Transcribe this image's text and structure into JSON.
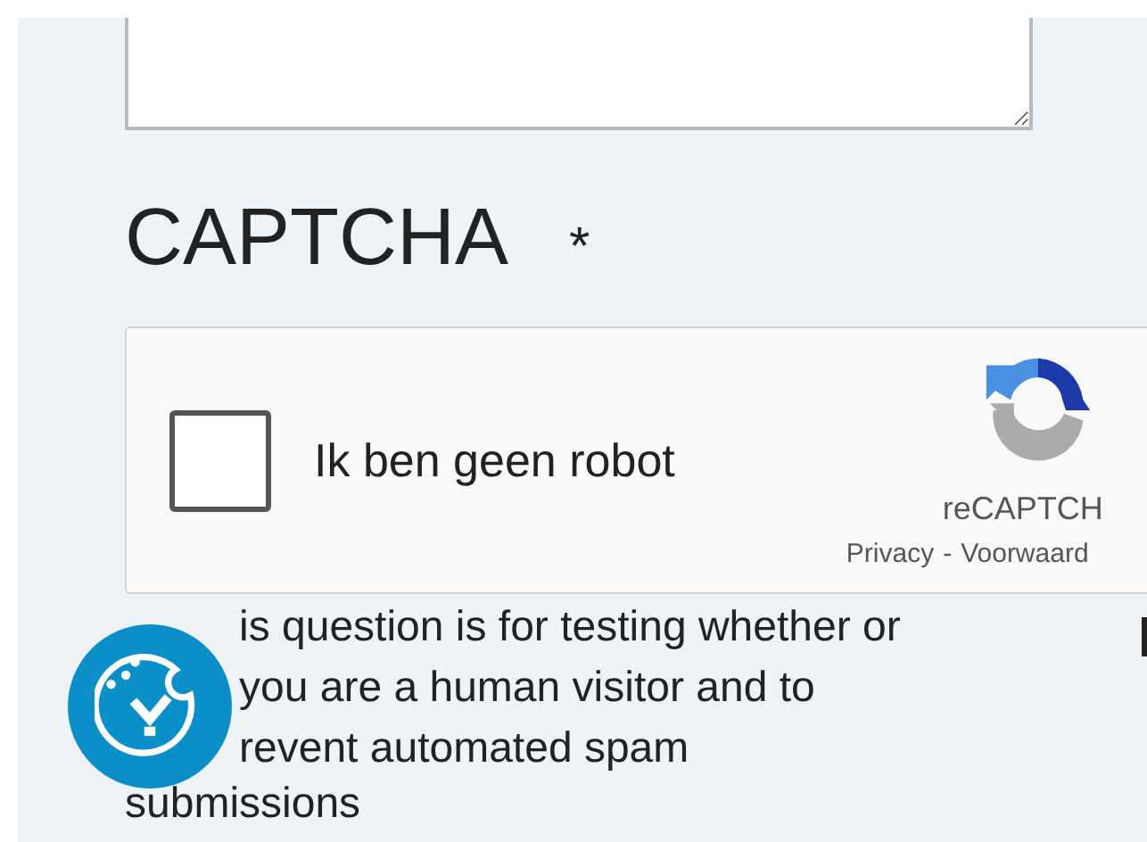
{
  "captcha": {
    "label": "CAPTCHA",
    "required_mark": "*",
    "widget": {
      "checkbox_label": "Ik ben geen robot",
      "checked": false,
      "brand": "reCAPTCH",
      "links": [
        {
          "label": "Privacy"
        },
        {
          "label": "Voorwaard"
        }
      ],
      "separator": "-"
    },
    "description_lines": [
      "is question is for testing whether or",
      "you are a human visitor and to",
      "revent automated spam",
      "submissions"
    ]
  }
}
